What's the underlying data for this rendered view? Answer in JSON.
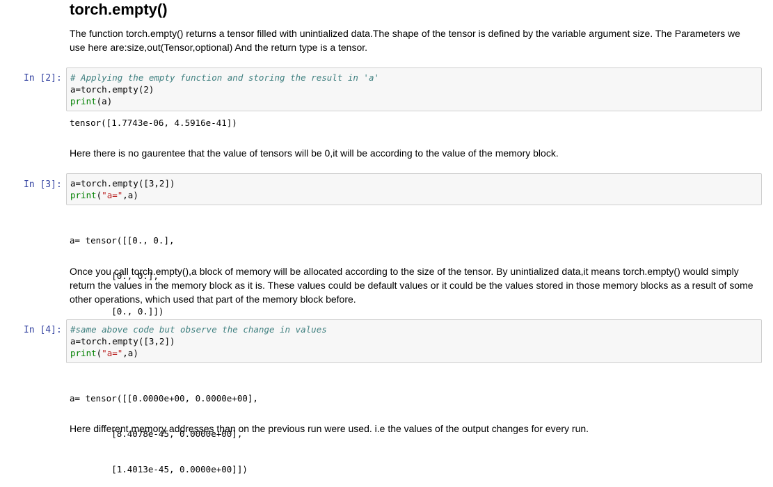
{
  "title": "torch.empty()",
  "intro": "The function torch.empty() returns a tensor filled with unintialized data.The shape of the tensor is defined by the variable argument size. The Parameters we use here are:size,out(Tensor,optional) And the return type is a tensor.",
  "cells": [
    {
      "prompt": "In [2]:",
      "code": {
        "comment": "# Applying the empty function and storing the result in 'a'",
        "line2": "a=torch.empty(2)",
        "print_kw": "print",
        "print_args": "(a)"
      },
      "output": [
        "tensor([1.7743e-06, 4.5916e-41])"
      ]
    },
    {
      "prompt": "In [3]:",
      "code": {
        "line1": "a=torch.empty([3,2])",
        "print_kw": "print",
        "print_open": "(",
        "print_str": "\"a=\"",
        "print_rest": ",a)"
      },
      "output": [
        "a= tensor([[0., 0.],",
        "        [0., 0.],",
        "        [0., 0.]])"
      ]
    },
    {
      "prompt": "In [4]:",
      "code": {
        "comment": "#same above code but observe the change in values",
        "line2": "a=torch.empty([3,2])",
        "print_kw": "print",
        "print_open": "(",
        "print_str": "\"a=\"",
        "print_rest": ",a)"
      },
      "output": [
        "a= tensor([[0.0000e+00, 0.0000e+00],",
        "        [8.4078e-45, 0.0000e+00],",
        "        [1.4013e-45, 0.0000e+00]])"
      ]
    }
  ],
  "note1": "Here there is no gaurentee that the value of tensors will be 0,it will be according to the value of the memory block.",
  "note2": "Once you call torch.empty(),a block of memory will be allocated according to the size of the tensor. By unintialized data,it means torch.empty() would simply return the values in the memory block as it is. These values could be default values or it could be the values stored in those memory blocks as a result of some other operations, which used that part of the memory block before.",
  "note3": "Here different memory addresses than on the previous run were used. i.e the values of the output changes for every run."
}
